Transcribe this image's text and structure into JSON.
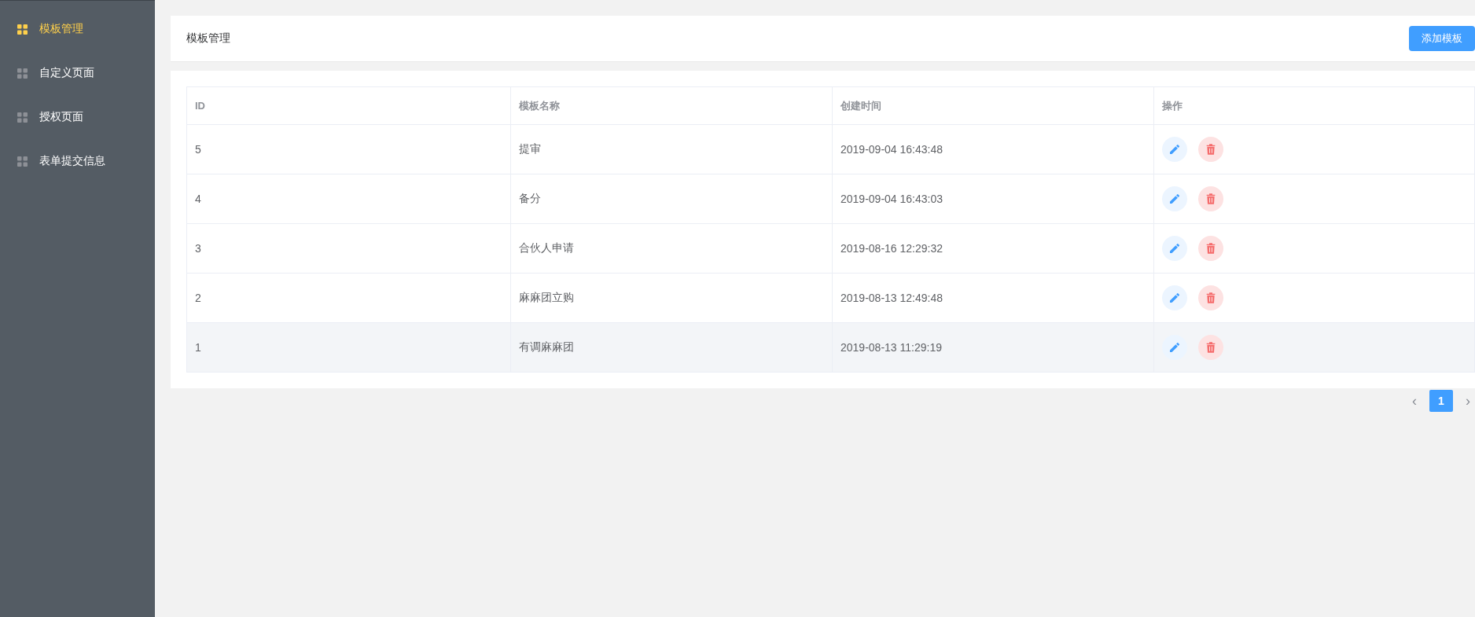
{
  "sidebar": {
    "items": [
      {
        "label": "模板管理",
        "selected": true
      },
      {
        "label": "自定义页面",
        "selected": false
      },
      {
        "label": "授权页面",
        "selected": false
      },
      {
        "label": "表单提交信息",
        "selected": false
      }
    ]
  },
  "header": {
    "title": "模板管理",
    "add_button": "添加模板"
  },
  "table": {
    "columns": [
      "ID",
      "模板名称",
      "创建时间",
      "操作"
    ],
    "rows": [
      {
        "id": "5",
        "name": "提审",
        "created": "2019-09-04 16:43:48",
        "highlighted": false
      },
      {
        "id": "4",
        "name": "备分",
        "created": "2019-09-04 16:43:03",
        "highlighted": false
      },
      {
        "id": "3",
        "name": "合伙人申请",
        "created": "2019-08-16 12:29:32",
        "highlighted": false
      },
      {
        "id": "2",
        "name": "麻麻团立购",
        "created": "2019-08-13 12:49:48",
        "highlighted": false
      },
      {
        "id": "1",
        "name": "有调麻麻团",
        "created": "2019-08-13 11:29:19",
        "highlighted": true
      }
    ]
  },
  "pagination": {
    "prev": "‹",
    "pages": [
      {
        "label": "1",
        "selected": true
      }
    ],
    "next": "›"
  }
}
